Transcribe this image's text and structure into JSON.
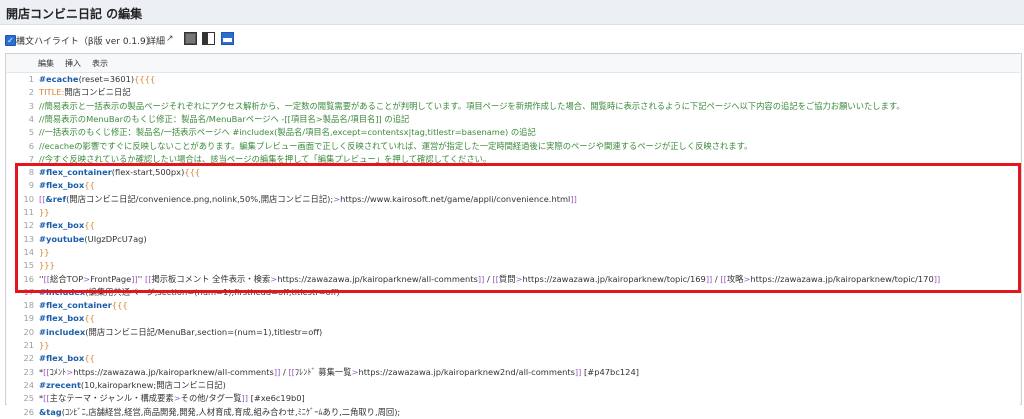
{
  "page": {
    "title": "開店コンビニ日記 の編集"
  },
  "options": {
    "syntax_highlight_label": "構文ハイライト（β版 ver 0.1.9）",
    "detail_link": "詳細",
    "syntax_highlight_checked": true
  },
  "menu": {
    "items": [
      "編集",
      "挿入",
      "表示"
    ]
  },
  "editor": {
    "lines": [
      {
        "n": "1",
        "text": "#ecache(reset=3601){{{{"
      },
      {
        "n": "2",
        "text": "TITLE:開店コンビニ日記"
      },
      {
        "n": "3",
        "text": "//簡易表示と一括表示の製品ページそれぞれにアクセス解析から、一定数の閲覧需要があることが判明しています。項目ページを新規作成した場合、閲覧時に表示されるように下記ページへ以下内容の追記をご協力お願いいたします。"
      },
      {
        "n": "4",
        "text": "//簡易表示のMenuBarのもくじ修正：製品名/MenuBarページへ -[[項目名>製品名/項目名]] の追記"
      },
      {
        "n": "5",
        "text": "//一括表示のもくじ修正：製品名/一括表示ページへ #includex(製品名/項目名,except=contentsx|tag,titlestr=basename) の追記"
      },
      {
        "n": "6",
        "text": "//ecacheの影響ですぐに反映しないことがあります。編集プレビュー画面で正しく反映されていれば、運営が指定した一定時間経過後に実際のページや関連するページが正しく反映されます。"
      },
      {
        "n": "7",
        "text": "//今すぐ反映されているか確認したい場合は、該当ページの編集を押して「編集プレビュー」を押して確認してください。"
      },
      {
        "n": "8",
        "text": "#flex_container(flex-start,500px){{{"
      },
      {
        "n": "9",
        "text": "#flex_box{{"
      },
      {
        "n": "10",
        "text": "[[&ref(開店コンビニ日記/convenience.png,nolink,50%,開店コンビニ日記);>https://www.kairosoft.net/game/appli/convenience.html]]"
      },
      {
        "n": "11",
        "text": "}}"
      },
      {
        "n": "12",
        "text": "#flex_box{{"
      },
      {
        "n": "13",
        "text": "#youtube(UIgzDPcU7ag)"
      },
      {
        "n": "14",
        "text": "}}"
      },
      {
        "n": "15",
        "text": "}}}"
      },
      {
        "n": "16",
        "text": "''[[総合TOP>FrontPage]]'' [[掲示板コメント 全件表示・検索>https://zawazawa.jp/kairoparknew/all-comments]] / [[質問>https://zawazawa.jp/kairoparknew/topic/169]] / [[攻略>https://zawazawa.jp/kairoparknew/topic/170]]"
      },
      {
        "n": "17",
        "text": "#includex(編集用共通ページ,section=(num=1),firsthead=off,titlestr=off)"
      },
      {
        "n": "18",
        "text": "#flex_container{{{"
      },
      {
        "n": "19",
        "text": "#flex_box{{"
      },
      {
        "n": "20",
        "text": "#includex(開店コンビニ日記/MenuBar,section=(num=1),titlestr=off)"
      },
      {
        "n": "21",
        "text": "}}"
      },
      {
        "n": "22",
        "text": "#flex_box{{"
      },
      {
        "n": "23",
        "text": "*[[ｺﾒﾝﾄ>https://zawazawa.jp/kairoparknew/all-comments]] / [[ﾌﾚﾝﾄﾞ 募集一覧>https://zawazawa.jp/kairoparknew2nd/all-comments]] [#p47bc124]"
      },
      {
        "n": "24",
        "text": "#zrecent(10,kairoparknew;開店コンビニ日記)"
      },
      {
        "n": "25",
        "text": "*[[主なテーマ・ジャンル・構成要素>その他/タグ一覧]] [#xe6c19b0]"
      },
      {
        "n": "26",
        "text": "&tag(ｺﾝﾋﾞﾆ,店舗経営,経営,商品開発,開発,人材育成,育成,組み合わせ,ﾐﾆｹﾞｰﾑあり,二角取り,周回);"
      }
    ]
  },
  "colors": {
    "macro": "#1c5faa",
    "comment": "#3c8a3c",
    "brace": "#d9822b",
    "link_bracket": "#9a5cc6",
    "highlight_box": "#e5151d",
    "checkbox": "#2d6fd1"
  }
}
